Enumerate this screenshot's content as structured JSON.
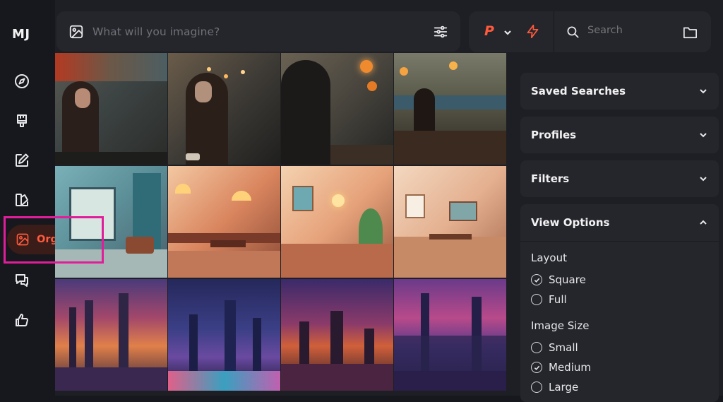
{
  "sidebar": {
    "logo": "MJ",
    "items": [
      {
        "icon": "compass-icon"
      },
      {
        "icon": "paintbrush-icon"
      },
      {
        "icon": "edit-icon"
      },
      {
        "icon": "palette-icon"
      },
      {
        "icon": "image-icon",
        "label": "Organize",
        "active": true
      },
      {
        "icon": "chat-icon"
      },
      {
        "icon": "thumbs-up-icon"
      }
    ]
  },
  "prompt": {
    "placeholder": "What will you imagine?"
  },
  "toolbar": {
    "profile_letter": "P",
    "search_placeholder": "Search"
  },
  "gallery": {
    "rows": [
      [
        "woman-at-rainy-cafe-window",
        "woman-with-coffee-by-window",
        "silhouette-rainy-window-lights",
        "woman-at-cafe-terrace-lamps"
      ],
      [
        "illustrated-cafe-interior-blue",
        "illustrated-cafe-warm-lights",
        "illustrated-cafe-plants",
        "illustrated-cafe-empty-tables"
      ],
      [
        "neon-city-skyline-sunset",
        "neon-city-skyline-night",
        "city-skyline-purple-sky",
        "city-skyline-pink-clouds"
      ]
    ]
  },
  "panels": {
    "saved_searches": "Saved Searches",
    "profiles": "Profiles",
    "filters": "Filters",
    "view_options": {
      "title": "View Options",
      "layout_label": "Layout",
      "layout_options": [
        "Square",
        "Full"
      ],
      "layout_selected": "Square",
      "size_label": "Image Size",
      "size_options": [
        "Small",
        "Medium",
        "Large"
      ],
      "size_selected": "Medium"
    }
  },
  "colors": {
    "accent": "#ff5a3c",
    "highlight_box": "#e01e9a",
    "panel_bg": "#25262c",
    "page_bg": "#1e1f24"
  }
}
